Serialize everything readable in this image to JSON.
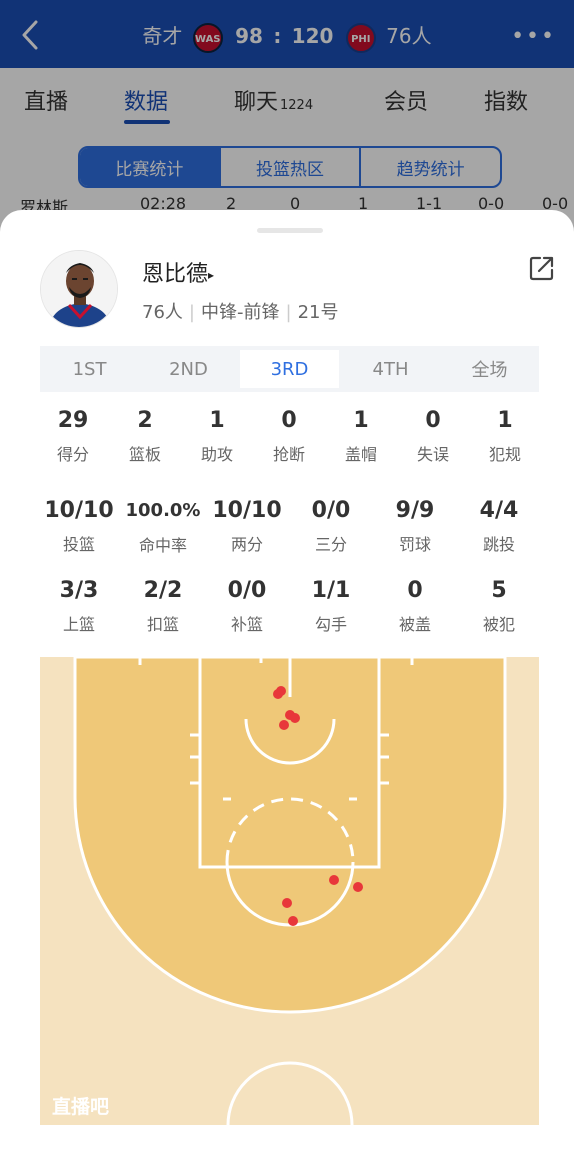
{
  "header": {
    "away_team": "奇才",
    "away_logo_text": "WAS",
    "away_score": "98",
    "separator": ":",
    "home_score": "120",
    "home_logo_text": "PHI",
    "home_team": "76人",
    "back_icon": "chevron-left-icon",
    "more_icon": "more-dots-icon"
  },
  "tabs": [
    {
      "label": "直播"
    },
    {
      "label": "数据"
    },
    {
      "label": "聊天",
      "count": "1224"
    },
    {
      "label": "会员"
    },
    {
      "label": "指数"
    }
  ],
  "subtabs": [
    {
      "label": "比赛统计"
    },
    {
      "label": "投篮热区"
    },
    {
      "label": "趋势统计"
    }
  ],
  "background_row": [
    "罗林斯",
    "02:28",
    "2",
    "0",
    "1",
    "1-1",
    "0-0",
    "0-0"
  ],
  "player": {
    "name": "恩比德",
    "arrow": "▸",
    "team": "76人",
    "position": "中锋-前锋",
    "number": "21号"
  },
  "quarters": [
    {
      "label": "1ST"
    },
    {
      "label": "2ND"
    },
    {
      "label": "3RD"
    },
    {
      "label": "4TH"
    },
    {
      "label": "全场"
    }
  ],
  "stats_row1": [
    {
      "value": "29",
      "label": "得分"
    },
    {
      "value": "2",
      "label": "篮板"
    },
    {
      "value": "1",
      "label": "助攻"
    },
    {
      "value": "0",
      "label": "抢断"
    },
    {
      "value": "1",
      "label": "盖帽"
    },
    {
      "value": "0",
      "label": "失误"
    },
    {
      "value": "1",
      "label": "犯规"
    }
  ],
  "stats_row2": [
    {
      "value": "10/10",
      "label": "投篮"
    },
    {
      "value": "100.0%",
      "label": "命中率"
    },
    {
      "value": "10/10",
      "label": "两分"
    },
    {
      "value": "0/0",
      "label": "三分"
    },
    {
      "value": "9/9",
      "label": "罚球"
    },
    {
      "value": "4/4",
      "label": "跳投"
    }
  ],
  "stats_row3": [
    {
      "value": "3/3",
      "label": "上篮"
    },
    {
      "value": "2/2",
      "label": "扣篮"
    },
    {
      "value": "0/0",
      "label": "补篮"
    },
    {
      "value": "1/1",
      "label": "勾手"
    },
    {
      "value": "0",
      "label": "被盖"
    },
    {
      "value": "5",
      "label": "被犯"
    }
  ],
  "watermark": "直播吧",
  "colors": {
    "brand_blue": "#1b4fb6",
    "accent_blue": "#2f6fe0",
    "court_inner": "#efc878",
    "court_outer": "#f5e2bf",
    "made_shot": "#e8373a"
  }
}
